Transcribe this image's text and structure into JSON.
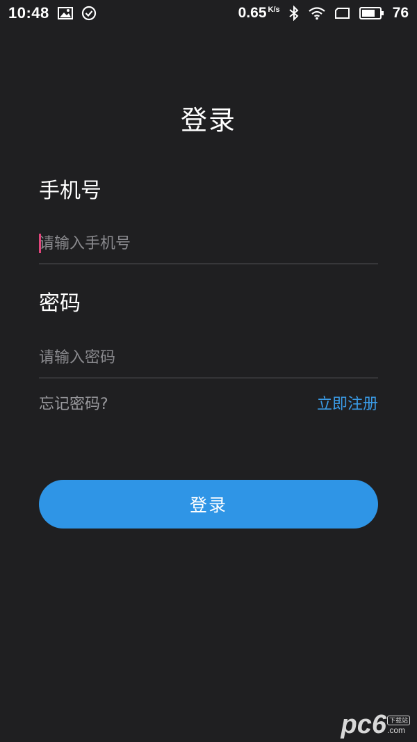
{
  "status_bar": {
    "time": "10:48",
    "net_speed": "0.65",
    "net_speed_unit": "K/s",
    "battery_level": "76",
    "icons": [
      "image-icon",
      "check-circle-icon",
      "bluetooth-icon",
      "wifi-icon",
      "screen-icon",
      "battery-icon"
    ]
  },
  "page": {
    "title": "登录"
  },
  "form": {
    "phone_label": "手机号",
    "phone_placeholder": "请输入手机号",
    "phone_value": "",
    "password_label": "密码",
    "password_placeholder": "请输入密码",
    "password_value": ""
  },
  "links": {
    "forgot_password": "忘记密码?",
    "register": "立即注册"
  },
  "actions": {
    "login_label": "登录"
  },
  "watermark": {
    "brand": "pc6",
    "badge": "下载站",
    "domain": ".com"
  },
  "colors": {
    "background": "#1f1f21",
    "accent": "#2f95e6",
    "link": "#3a9be6",
    "cursor": "#e0457b"
  }
}
